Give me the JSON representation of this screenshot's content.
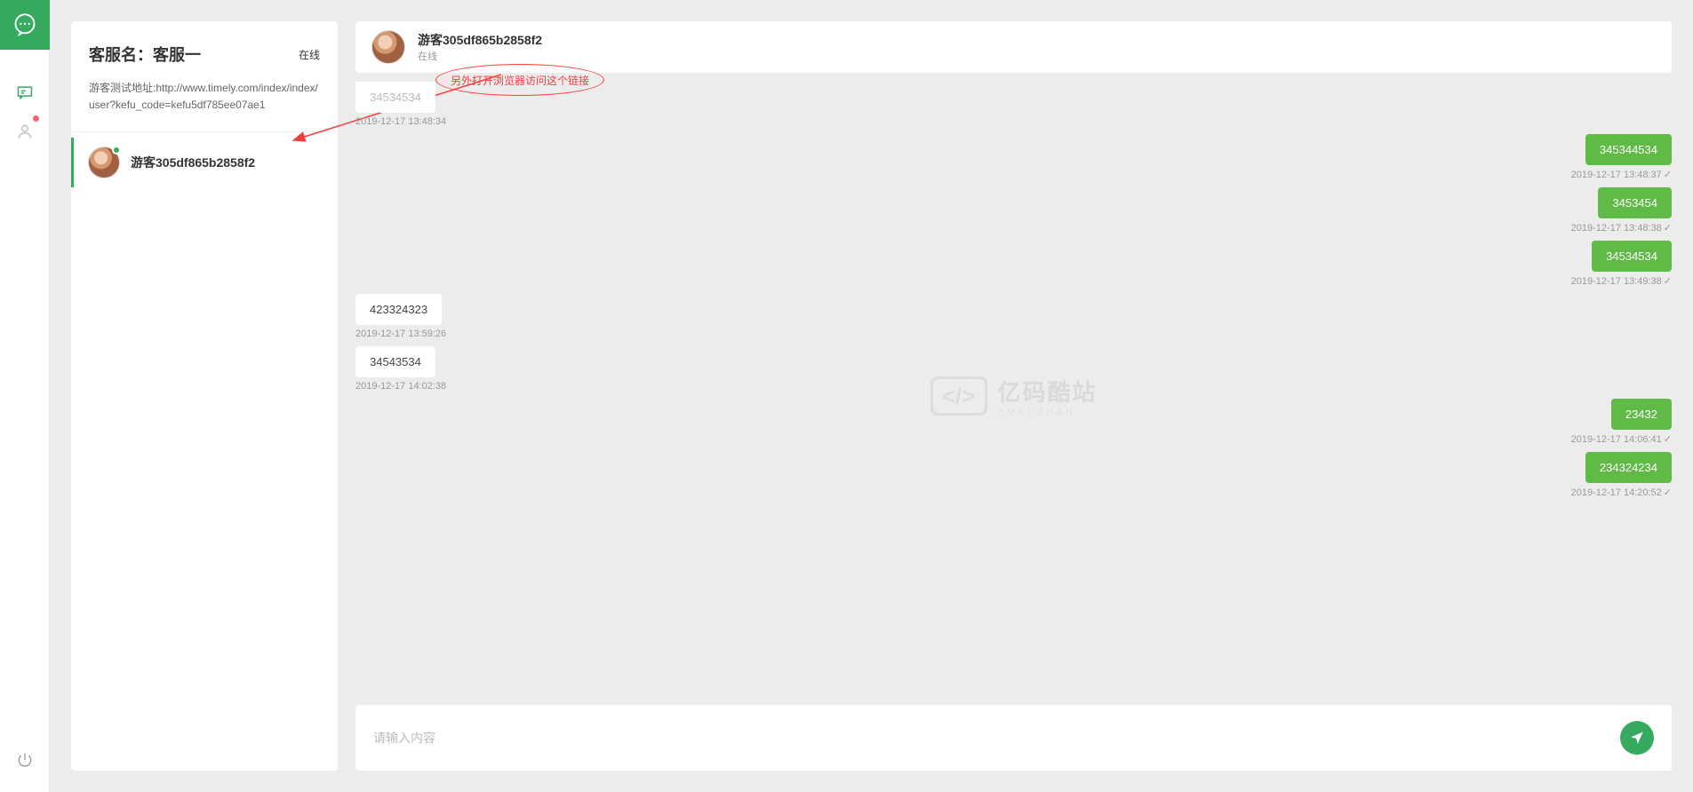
{
  "sidebar": {
    "title": "客服名：客服一",
    "status": "在线",
    "test_info": "游客测试地址:http://www.timely.com/index/index/user?kefu_code=kefu5df785ee07ae1",
    "contact_name": "游客305df865b2858f2"
  },
  "chat_header": {
    "name": "游客305df865b2858f2",
    "status": "在线"
  },
  "annotation": "另外打开浏览器访问这个链接",
  "messages": [
    {
      "side": "rcv",
      "text": "34534534",
      "time": "2019-12-17 13:48:34",
      "first": true
    },
    {
      "side": "snd",
      "text": "345344534",
      "time": "2019-12-17 13:48:37"
    },
    {
      "side": "snd",
      "text": "3453454",
      "time": "2019-12-17 13:48:38"
    },
    {
      "side": "snd",
      "text": "34534534",
      "time": "2019-12-17 13:49:38"
    },
    {
      "side": "rcv",
      "text": "423324323",
      "time": "2019-12-17 13:59:26"
    },
    {
      "side": "rcv",
      "text": "34543534",
      "time": "2019-12-17 14:02:38"
    },
    {
      "side": "snd",
      "text": "23432",
      "time": "2019-12-17 14:06:41"
    },
    {
      "side": "snd",
      "text": "234324234",
      "time": "2019-12-17 14:20:52"
    }
  ],
  "input": {
    "placeholder": "请输入内容"
  },
  "watermark": {
    "main": "亿码酷站",
    "sub": "YMKUZHAN"
  }
}
